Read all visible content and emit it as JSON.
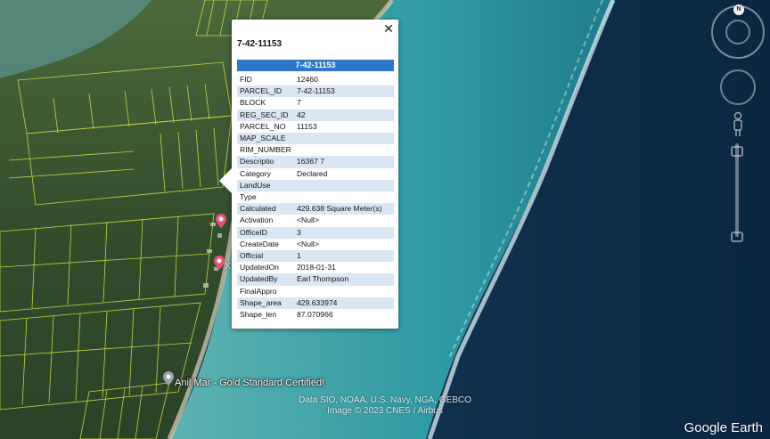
{
  "popup": {
    "title": "7-42-11153",
    "header": "7-42-11153",
    "close_glyph": "✕",
    "rows": [
      {
        "key": "FID",
        "value": "12460"
      },
      {
        "key": "PARCEL_ID",
        "value": "7-42-11153"
      },
      {
        "key": "BLOCK",
        "value": "7"
      },
      {
        "key": "REG_SEC_ID",
        "value": "42"
      },
      {
        "key": "PARCEL_NO",
        "value": "11153"
      },
      {
        "key": "MAP_SCALE",
        "value": ""
      },
      {
        "key": "RIM_NUMBER",
        "value": ""
      },
      {
        "key": "Descriptio",
        "value": "16367 7"
      },
      {
        "key": "Category",
        "value": "Declared"
      },
      {
        "key": "LandUse",
        "value": ""
      },
      {
        "key": "Type",
        "value": ""
      },
      {
        "key": "Calculated",
        "value": "429.638 Square Meter(s)"
      },
      {
        "key": "Activation",
        "value": "<Null>"
      },
      {
        "key": "OfficeID",
        "value": "3"
      },
      {
        "key": "CreateDate",
        "value": "<Null>"
      },
      {
        "key": "Official",
        "value": "1"
      },
      {
        "key": "UpdatedOn",
        "value": "2018-01-31"
      },
      {
        "key": "UpdatedBy",
        "value": "Earl Thompson"
      },
      {
        "key": "FinalAppro",
        "value": ""
      },
      {
        "key": "Shape_area",
        "value": "429.633974"
      },
      {
        "key": "Shape_len",
        "value": "87.070966"
      }
    ]
  },
  "map": {
    "place_label": "Anil Mar - Gold Standard Certified!",
    "attribution_line1": "Data SIO, NOAA, U.S. Navy, NGA, GEBCO",
    "attribution_line2": "Image © 2023 CNES / Airbus",
    "logo": "Google Earth",
    "poi_marker_label": "X"
  },
  "nav": {
    "compass_label": "N"
  },
  "colors": {
    "header_bg": "#2e77c9",
    "row_alt": "#dbe6f4",
    "parcel_lines": "#e2e84a",
    "deep_ocean": "#0d2c47",
    "lagoon": "#3aa3a8"
  }
}
